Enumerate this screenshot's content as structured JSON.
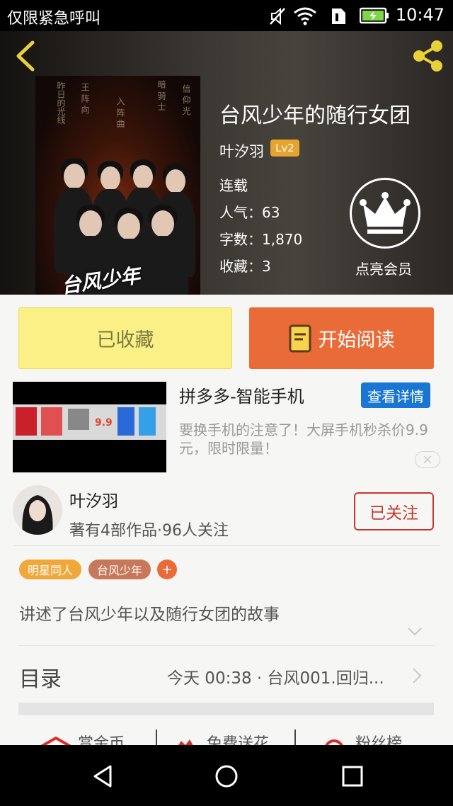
{
  "status_bar": {
    "carrier": "仅限紧急呼叫",
    "time": "10:47",
    "icons": [
      "mute-icon",
      "wifi-icon",
      "sim-icon",
      "battery-icon"
    ]
  },
  "header": {
    "back_icon": "chevron-left-icon",
    "share_icon": "share-icon"
  },
  "cover": {
    "title_text": "台风少年"
  },
  "book": {
    "title": "台风少年的随行女团",
    "author": "叶汐羽",
    "level": "Lv2",
    "status": "连载",
    "popularity": "人气：63",
    "word_count": "字数：1,870",
    "favorites": "收藏：3"
  },
  "vip": {
    "label": "点亮会员",
    "icon": "crown-icon"
  },
  "actions": {
    "collected": "已收藏",
    "start_read": "开始阅读"
  },
  "ad": {
    "title": "拼多多-智能手机",
    "button": "查看详情",
    "description": "要换手机的注意了！大屏手机秒杀价9.9元，限时限量！",
    "price_tag": "9.9"
  },
  "author_card": {
    "name": "叶汐羽",
    "info": "著有4部作品·96人关注",
    "follow": "已关注"
  },
  "tags": [
    {
      "label": "明星同人",
      "color": "#f0a83b"
    },
    {
      "label": "台风少年",
      "color": "#c8785a"
    },
    {
      "label": "+",
      "color": "#e96b38"
    }
  ],
  "synopsis": "讲述了台风少年以及随行女团的故事",
  "toc": {
    "label": "目录",
    "latest": "今天 00:38 · 台风001.回归..."
  },
  "bottom_actions": [
    {
      "label": "赏金币",
      "icon": "envelope-icon"
    },
    {
      "label": "免费送花",
      "icon": "flower-icon"
    },
    {
      "label": "粉丝榜",
      "icon": "ranking-icon"
    }
  ],
  "colors": {
    "accent": "#e96b38",
    "collected_bg": "#faf085",
    "ad_button": "#1976d2",
    "follow": "#c8372d"
  }
}
